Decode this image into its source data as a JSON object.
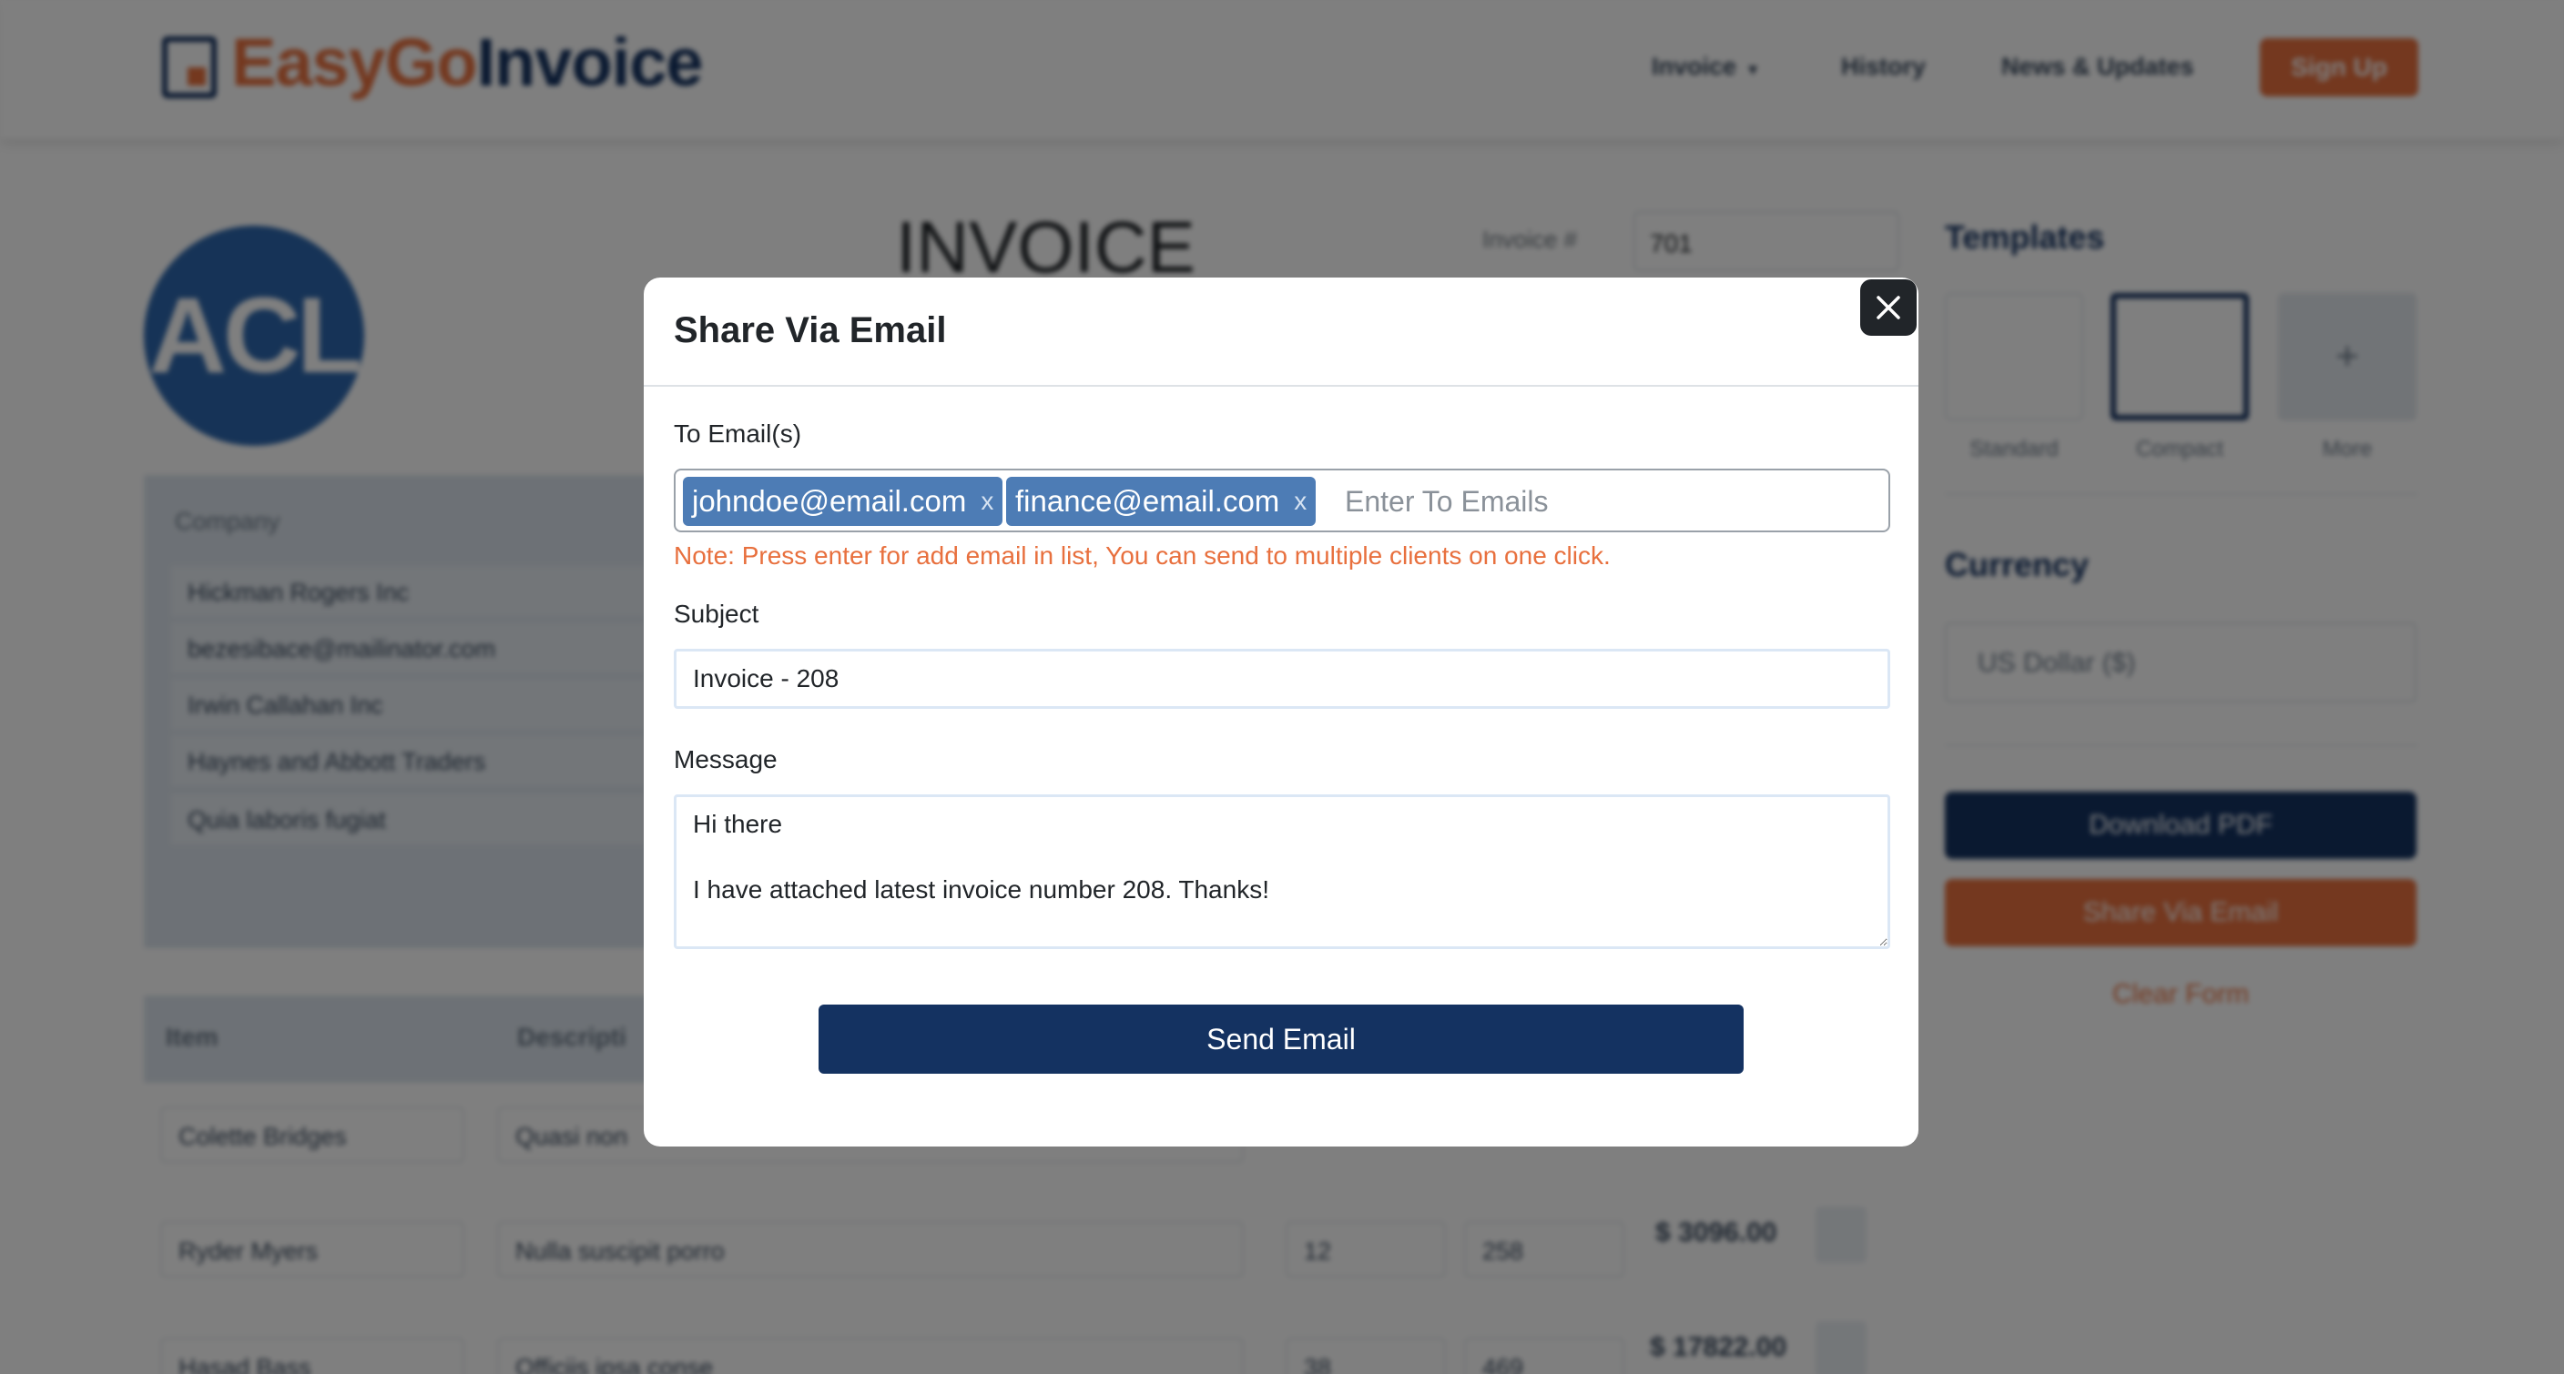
{
  "background": {
    "brand": {
      "part1": "EasyGo",
      "part2": "Invoice"
    },
    "nav": {
      "invoice": "Invoice",
      "history": "History",
      "news": "News & Updates",
      "signup": "Sign Up"
    },
    "logo_text": "ACL",
    "invoice_title": "INVOICE",
    "invoice_number_label": "Invoice #",
    "invoice_number": "701",
    "company": {
      "title": "Company",
      "lines": [
        "Hickman Rogers Inc",
        "bezesibace@mailinator.com",
        "Irwin Callahan Inc",
        "Haynes and Abbott Traders",
        "Quia laboris fugiat"
      ]
    },
    "items_header": {
      "item": "Item",
      "description": "Descripti"
    },
    "rows": [
      {
        "item": "Colette Bridges",
        "description": "Quasi non",
        "qty": "",
        "rate": "",
        "amount": ""
      },
      {
        "item": "Ryder Myers",
        "description": "Nulla suscipit porro",
        "qty": "12",
        "rate": "258",
        "amount": "$ 3096.00"
      },
      {
        "item": "Hasad Bass",
        "description": "Officiis ipsa conse",
        "qty": "38",
        "rate": "469",
        "amount": "$ 17822.00"
      }
    ],
    "templates_title": "Templates",
    "templates": [
      "Standard",
      "Compact",
      "More"
    ],
    "template_more_symbol": "+",
    "currency_title": "Currency",
    "currency_value": "US Dollar ($)",
    "download_pdf": "Download PDF",
    "share_via_email": "Share Via Email",
    "clear_form": "Clear Form"
  },
  "modal": {
    "title": "Share Via Email",
    "to_label": "To Email(s)",
    "emails": [
      {
        "address": "johndoe@email.com",
        "remove": "x"
      },
      {
        "address": "finance@email.com",
        "remove": "x"
      }
    ],
    "to_placeholder": "Enter To Emails",
    "note": "Note: Press enter for add email in list, You can send to multiple clients on one click.",
    "subject_label": "Subject",
    "subject_value": "Invoice - 208",
    "message_label": "Message",
    "message_value": "Hi there\n\nI have attached latest invoice number 208. Thanks!",
    "send_button": "Send Email"
  },
  "colors": {
    "brand_orange": "#e8703e",
    "brand_navy": "#143261",
    "chip_blue": "#4d7cb5",
    "overlay": "rgba(0,0,0,0.5)"
  },
  "icons": {
    "close": "close-icon",
    "dropdown": "chevron-down-icon",
    "logo": "invoice-logo-icon"
  }
}
